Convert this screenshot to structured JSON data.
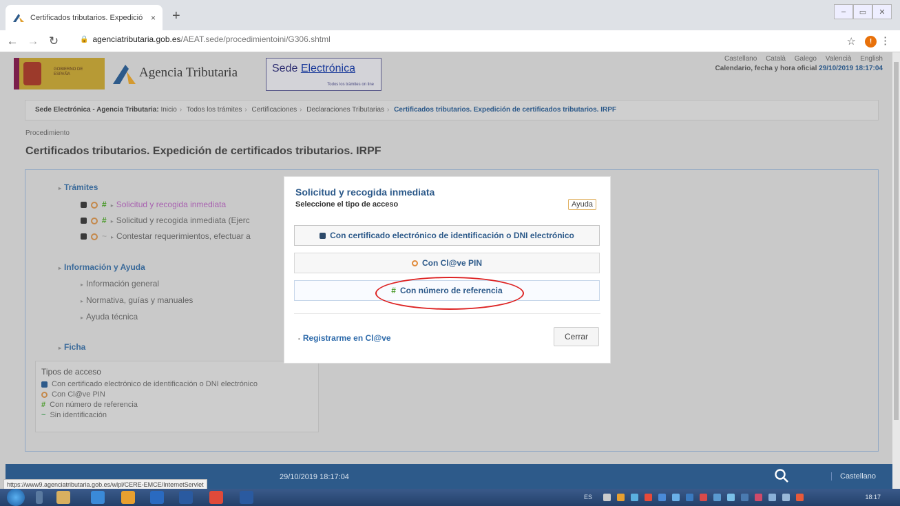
{
  "browser": {
    "tab_title": "Certificados tributarios. Expedició",
    "tab_close": "×",
    "new_tab": "+",
    "url_host": "agenciatributaria.gob.es",
    "url_path": "/AEAT.sede/procedimientoini/G306.shtml",
    "status_url": "https://www9.agenciatributaria.gob.es/wlpl/CERE-EMCE/InternetServlet"
  },
  "header": {
    "gov_text": "GOBIERNO DE ESPAÑA",
    "agency_name": "Agencia Tributaria",
    "sede_title_a": "Sede ",
    "sede_title_b": "Electrónica",
    "sede_sub": "Todos los trámites on line",
    "languages": [
      "Castellano",
      "Català",
      "Galego",
      "Valencià",
      "English"
    ],
    "calendar_label": "Calendario, fecha y hora oficial",
    "calendar_date": "29/10/2019 18:17:04"
  },
  "breadcrumb": {
    "root": "Sede Electrónica - Agencia Tributaria:",
    "items": [
      "Inicio",
      "Todos los trámites",
      "Certificaciones",
      "Declaraciones Tributarias"
    ],
    "current": "Certificados tributarios. Expedición de certificados tributarios. IRPF",
    "separator": "›"
  },
  "procedure": {
    "label": "Procedimiento",
    "title": "Certificados tributarios. Expedición de certificados tributarios. IRPF"
  },
  "sections": {
    "tramites": {
      "title": "Trámites",
      "items": [
        "Solicitud y recogida inmediata",
        "Solicitud y recogida inmediata (Ejerc",
        "Contestar requerimientos, efectuar a"
      ]
    },
    "info": {
      "title": "Información y Ayuda",
      "items": [
        "Información general",
        "Normativa, guías y manuales",
        "Ayuda técnica"
      ]
    },
    "ficha": {
      "title": "Ficha"
    }
  },
  "access_types": {
    "title": "Tipos de acceso",
    "items": [
      "Con certificado electrónico de identificación o DNI electrónico",
      "Con Cl@ve PIN",
      "Con número de referencia",
      "Sin identificación"
    ]
  },
  "footer": {
    "date": "29/10/2019 18:17:04",
    "language": "Castellano"
  },
  "modal": {
    "title": "Solicitud y recogida inmediata",
    "subtitle": "Seleccione el tipo de acceso",
    "help_label": "Ayuda",
    "options": [
      "Con certificado electrónico de identificación o DNI electrónico",
      "Con Cl@ve PIN",
      "Con número de referencia"
    ],
    "register_link": "Registrarme en Cl@ve",
    "close_label": "Cerrar"
  },
  "taskbar": {
    "language": "ES",
    "time": "18:17"
  },
  "colors": {
    "accent_blue": "#2d5a8a",
    "highlight_red": "#d22222",
    "reference_green": "#4a9a2a"
  }
}
